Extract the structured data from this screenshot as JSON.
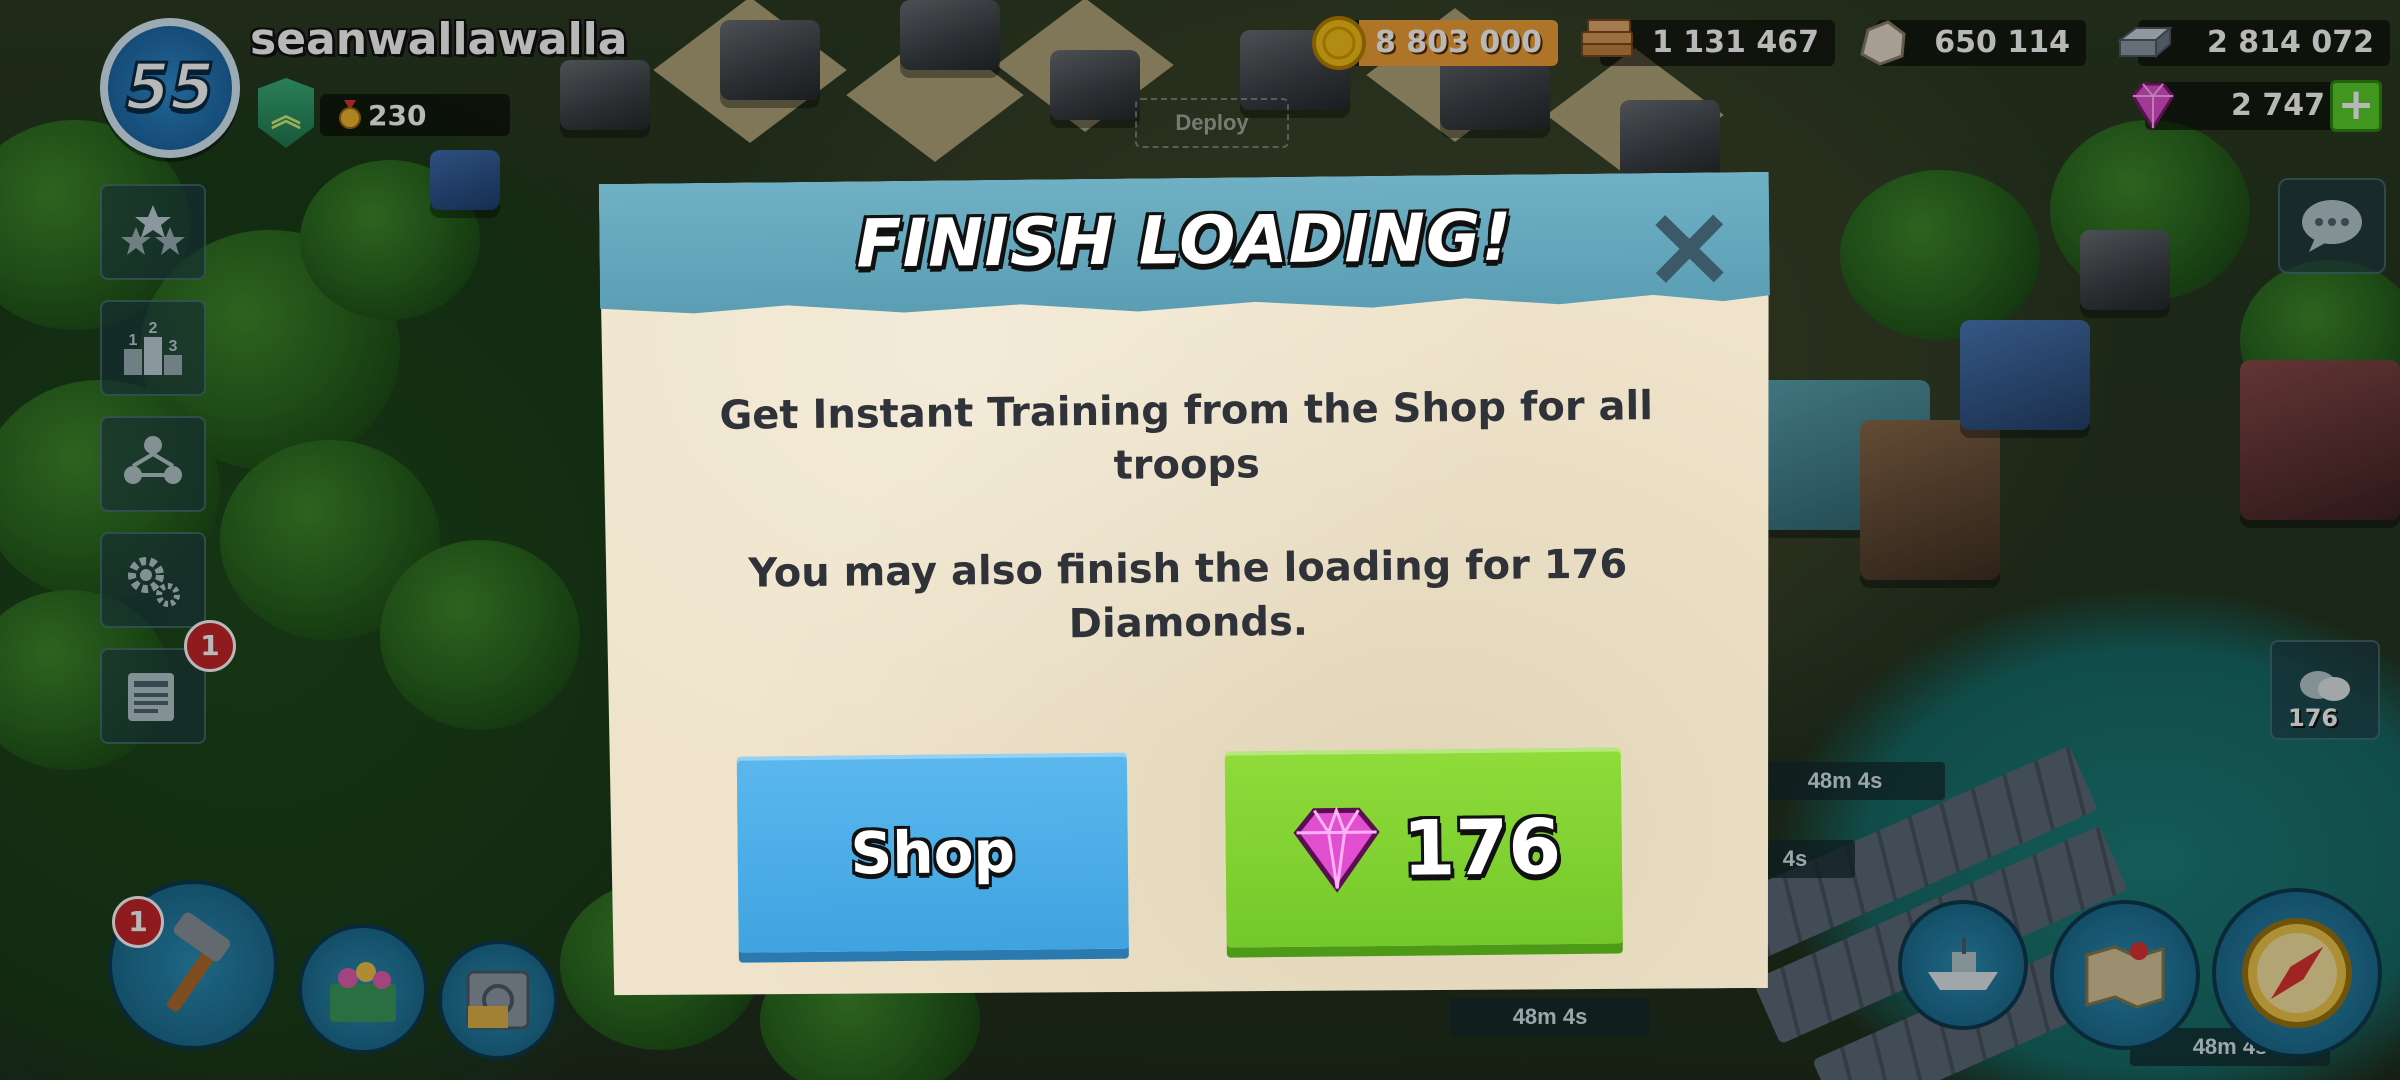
{
  "player": {
    "name": "seanwallawalla",
    "level": "55",
    "medals": "230"
  },
  "resources": {
    "gold": "8 803 000",
    "wood": "1 131 467",
    "stone": "650 114",
    "iron": "2 814 072",
    "diamonds": "2 747"
  },
  "world": {
    "deploy_label": "Deploy",
    "timers": [
      "48m 4s",
      "4s",
      "48m 4s",
      "48m 4s"
    ],
    "boat_count": "176"
  },
  "sidebar": {
    "reports_badge": "1",
    "builder_badge": "1"
  },
  "dialog": {
    "title": "FINISH LOADING!",
    "message_1": "Get Instant Training from the Shop for all troops",
    "message_2": "You may also finish the loading for 176 Diamonds.",
    "shop_label": "Shop",
    "diamond_cost": "176"
  },
  "colors": {
    "header_blue": "#5a9db3",
    "shop_blue": "#3fa3e0",
    "gem_green": "#74c82a",
    "gold": "#f1a136",
    "diamond_pink": "#e14fd0"
  }
}
